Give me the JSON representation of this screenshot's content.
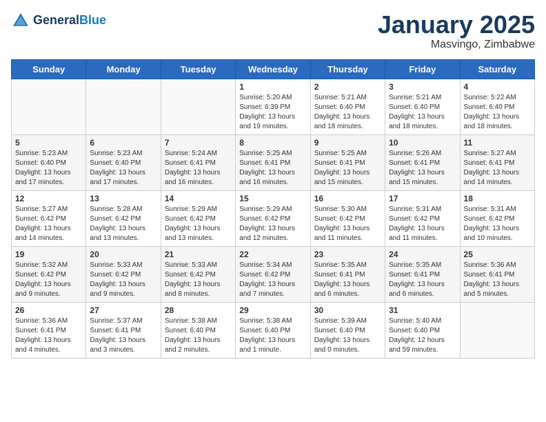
{
  "header": {
    "logo_line1": "General",
    "logo_line2": "Blue",
    "month": "January 2025",
    "location": "Masvingo, Zimbabwe"
  },
  "weekdays": [
    "Sunday",
    "Monday",
    "Tuesday",
    "Wednesday",
    "Thursday",
    "Friday",
    "Saturday"
  ],
  "weeks": [
    [
      {
        "day": "",
        "info": ""
      },
      {
        "day": "",
        "info": ""
      },
      {
        "day": "",
        "info": ""
      },
      {
        "day": "1",
        "info": "Sunrise: 5:20 AM\nSunset: 6:39 PM\nDaylight: 13 hours\nand 19 minutes."
      },
      {
        "day": "2",
        "info": "Sunrise: 5:21 AM\nSunset: 6:40 PM\nDaylight: 13 hours\nand 18 minutes."
      },
      {
        "day": "3",
        "info": "Sunrise: 5:21 AM\nSunset: 6:40 PM\nDaylight: 13 hours\nand 18 minutes."
      },
      {
        "day": "4",
        "info": "Sunrise: 5:22 AM\nSunset: 6:40 PM\nDaylight: 13 hours\nand 18 minutes."
      }
    ],
    [
      {
        "day": "5",
        "info": "Sunrise: 5:23 AM\nSunset: 6:40 PM\nDaylight: 13 hours\nand 17 minutes."
      },
      {
        "day": "6",
        "info": "Sunrise: 5:23 AM\nSunset: 6:40 PM\nDaylight: 13 hours\nand 17 minutes."
      },
      {
        "day": "7",
        "info": "Sunrise: 5:24 AM\nSunset: 6:41 PM\nDaylight: 13 hours\nand 16 minutes."
      },
      {
        "day": "8",
        "info": "Sunrise: 5:25 AM\nSunset: 6:41 PM\nDaylight: 13 hours\nand 16 minutes."
      },
      {
        "day": "9",
        "info": "Sunrise: 5:25 AM\nSunset: 6:41 PM\nDaylight: 13 hours\nand 15 minutes."
      },
      {
        "day": "10",
        "info": "Sunrise: 5:26 AM\nSunset: 6:41 PM\nDaylight: 13 hours\nand 15 minutes."
      },
      {
        "day": "11",
        "info": "Sunrise: 5:27 AM\nSunset: 6:41 PM\nDaylight: 13 hours\nand 14 minutes."
      }
    ],
    [
      {
        "day": "12",
        "info": "Sunrise: 5:27 AM\nSunset: 6:42 PM\nDaylight: 13 hours\nand 14 minutes."
      },
      {
        "day": "13",
        "info": "Sunrise: 5:28 AM\nSunset: 6:42 PM\nDaylight: 13 hours\nand 13 minutes."
      },
      {
        "day": "14",
        "info": "Sunrise: 5:29 AM\nSunset: 6:42 PM\nDaylight: 13 hours\nand 13 minutes."
      },
      {
        "day": "15",
        "info": "Sunrise: 5:29 AM\nSunset: 6:42 PM\nDaylight: 13 hours\nand 12 minutes."
      },
      {
        "day": "16",
        "info": "Sunrise: 5:30 AM\nSunset: 6:42 PM\nDaylight: 13 hours\nand 11 minutes."
      },
      {
        "day": "17",
        "info": "Sunrise: 5:31 AM\nSunset: 6:42 PM\nDaylight: 13 hours\nand 11 minutes."
      },
      {
        "day": "18",
        "info": "Sunrise: 5:31 AM\nSunset: 6:42 PM\nDaylight: 13 hours\nand 10 minutes."
      }
    ],
    [
      {
        "day": "19",
        "info": "Sunrise: 5:32 AM\nSunset: 6:42 PM\nDaylight: 13 hours\nand 9 minutes."
      },
      {
        "day": "20",
        "info": "Sunrise: 5:33 AM\nSunset: 6:42 PM\nDaylight: 13 hours\nand 9 minutes."
      },
      {
        "day": "21",
        "info": "Sunrise: 5:33 AM\nSunset: 6:42 PM\nDaylight: 13 hours\nand 8 minutes."
      },
      {
        "day": "22",
        "info": "Sunrise: 5:34 AM\nSunset: 6:42 PM\nDaylight: 13 hours\nand 7 minutes."
      },
      {
        "day": "23",
        "info": "Sunrise: 5:35 AM\nSunset: 6:41 PM\nDaylight: 13 hours\nand 6 minutes."
      },
      {
        "day": "24",
        "info": "Sunrise: 5:35 AM\nSunset: 6:41 PM\nDaylight: 13 hours\nand 6 minutes."
      },
      {
        "day": "25",
        "info": "Sunrise: 5:36 AM\nSunset: 6:41 PM\nDaylight: 13 hours\nand 5 minutes."
      }
    ],
    [
      {
        "day": "26",
        "info": "Sunrise: 5:36 AM\nSunset: 6:41 PM\nDaylight: 13 hours\nand 4 minutes."
      },
      {
        "day": "27",
        "info": "Sunrise: 5:37 AM\nSunset: 6:41 PM\nDaylight: 13 hours\nand 3 minutes."
      },
      {
        "day": "28",
        "info": "Sunrise: 5:38 AM\nSunset: 6:40 PM\nDaylight: 13 hours\nand 2 minutes."
      },
      {
        "day": "29",
        "info": "Sunrise: 5:38 AM\nSunset: 6:40 PM\nDaylight: 13 hours\nand 1 minute."
      },
      {
        "day": "30",
        "info": "Sunrise: 5:39 AM\nSunset: 6:40 PM\nDaylight: 13 hours\nand 0 minutes."
      },
      {
        "day": "31",
        "info": "Sunrise: 5:40 AM\nSunset: 6:40 PM\nDaylight: 12 hours\nand 59 minutes."
      },
      {
        "day": "",
        "info": ""
      }
    ]
  ]
}
